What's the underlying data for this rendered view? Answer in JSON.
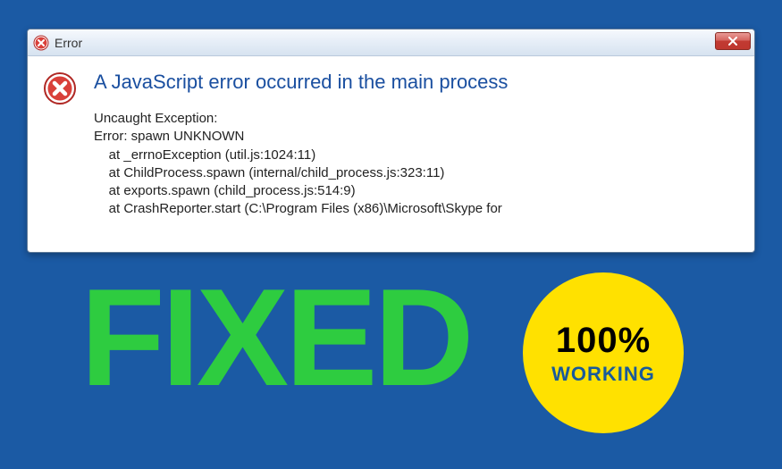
{
  "dialog": {
    "title": "Error",
    "main_message": "A JavaScript error occurred in the main process",
    "exception_heading": "Uncaught Exception:",
    "error_line": "Error: spawn UNKNOWN",
    "stack": [
      "    at _errnoException (util.js:1024:11)",
      "    at ChildProcess.spawn (internal/child_process.js:323:11)",
      "    at exports.spawn (child_process.js:514:9)",
      "    at CrashReporter.start (C:\\Program Files (x86)\\Microsoft\\Skype for"
    ]
  },
  "promo": {
    "fixed": "FIXED",
    "badge_top": "100%",
    "badge_bottom": "WORKING"
  }
}
